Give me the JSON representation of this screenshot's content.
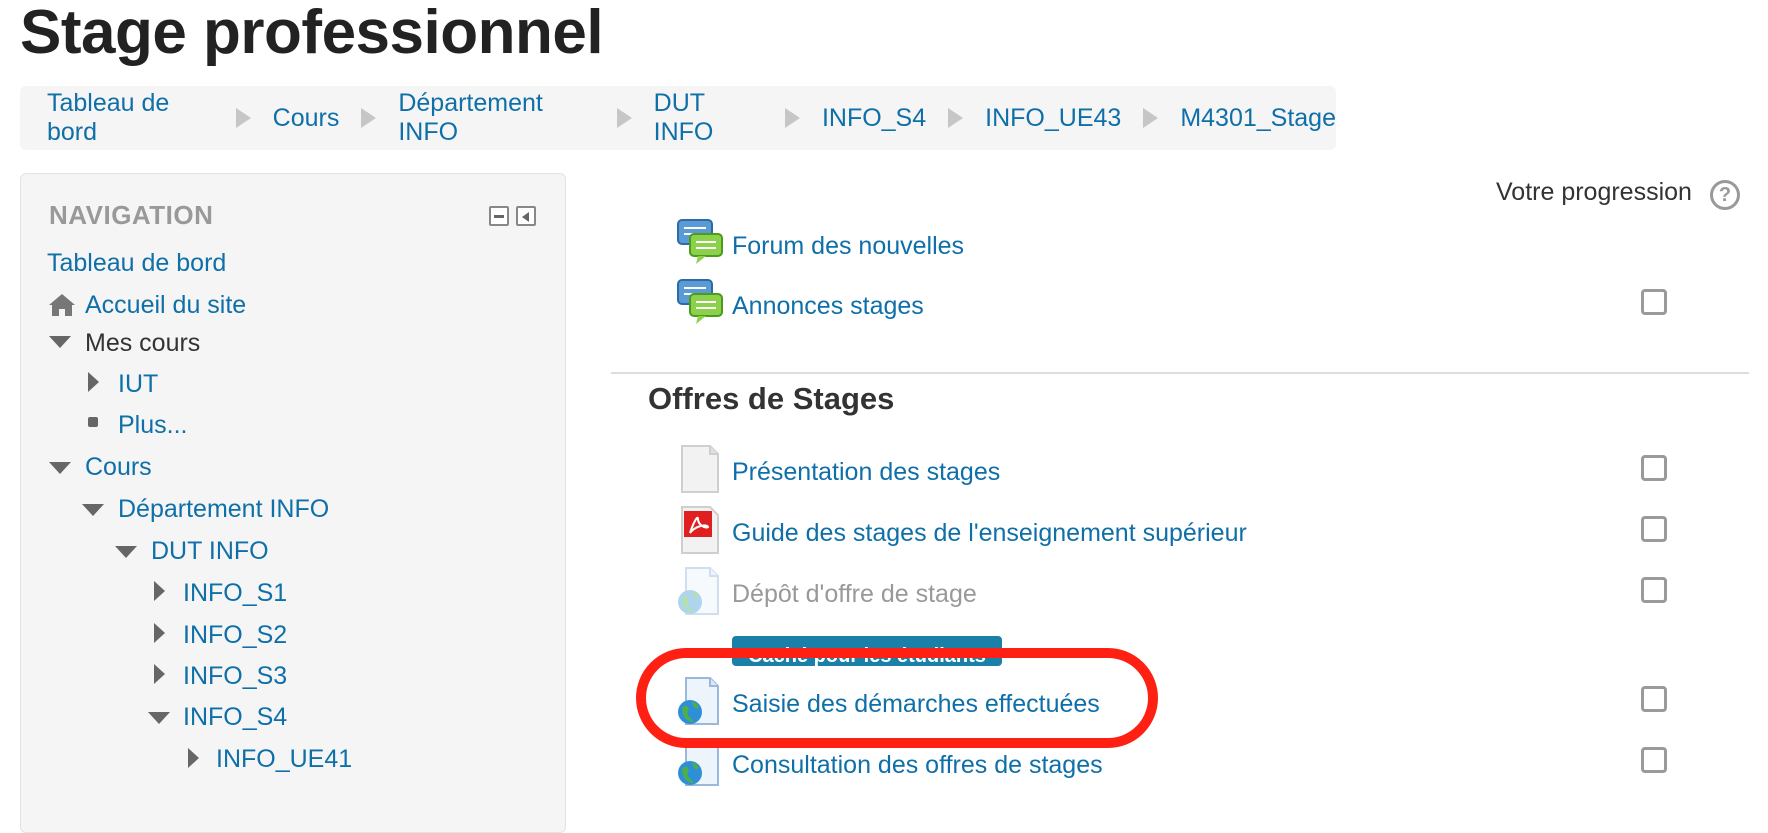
{
  "page": {
    "title": "Stage professionnel"
  },
  "breadcrumb": [
    "Tableau de bord",
    "Cours",
    "Département INFO",
    "DUT INFO",
    "INFO_S4",
    "INFO_UE43",
    "M4301_Stage"
  ],
  "navigation": {
    "title": "NAVIGATION",
    "items": [
      {
        "label": "Tableau de bord",
        "type": "link"
      },
      {
        "label": "Accueil du site",
        "type": "link",
        "icon": "home-icon"
      },
      {
        "label": "Mes cours",
        "type": "expanded-plain"
      },
      {
        "label": "IUT",
        "type": "collapsed"
      },
      {
        "label": "Plus...",
        "type": "bullet"
      },
      {
        "label": "Cours",
        "type": "expanded"
      },
      {
        "label": "Département INFO",
        "type": "expanded"
      },
      {
        "label": "DUT INFO",
        "type": "expanded"
      },
      {
        "label": "INFO_S1",
        "type": "collapsed"
      },
      {
        "label": "INFO_S2",
        "type": "collapsed"
      },
      {
        "label": "INFO_S3",
        "type": "collapsed"
      },
      {
        "label": "INFO_S4",
        "type": "expanded"
      },
      {
        "label": "INFO_UE41",
        "type": "collapsed"
      }
    ]
  },
  "main": {
    "progress_label": "Votre progression",
    "help_icon": "question-circle-icon",
    "top_activities": [
      {
        "label": "Forum des nouvelles",
        "icon": "forum-icon",
        "checkbox": false
      },
      {
        "label": "Annonces stages",
        "icon": "forum-icon",
        "checkbox": true
      }
    ],
    "section": {
      "title": "Offres de Stages",
      "activities": [
        {
          "label": "Présentation des stages",
          "icon": "file-icon",
          "checkbox": true
        },
        {
          "label": "Guide des stages de l'enseignement supérieur",
          "icon": "pdf-icon",
          "checkbox": true
        },
        {
          "label": "Dépôt d'offre de stage",
          "icon": "url-globe-icon",
          "checkbox": true,
          "dimmed": true
        },
        {
          "label": "Saisie des démarches effectuées",
          "icon": "url-globe-icon",
          "checkbox": true,
          "highlighted": true
        },
        {
          "label": "Consultation des offres de stages",
          "icon": "url-globe-icon",
          "checkbox": true
        }
      ],
      "hidden_badge": "Caché pour les étudiants"
    }
  },
  "colors": {
    "link": "#0f6fa8",
    "highlight": "#ff2014",
    "badge": "#1b80a8"
  }
}
